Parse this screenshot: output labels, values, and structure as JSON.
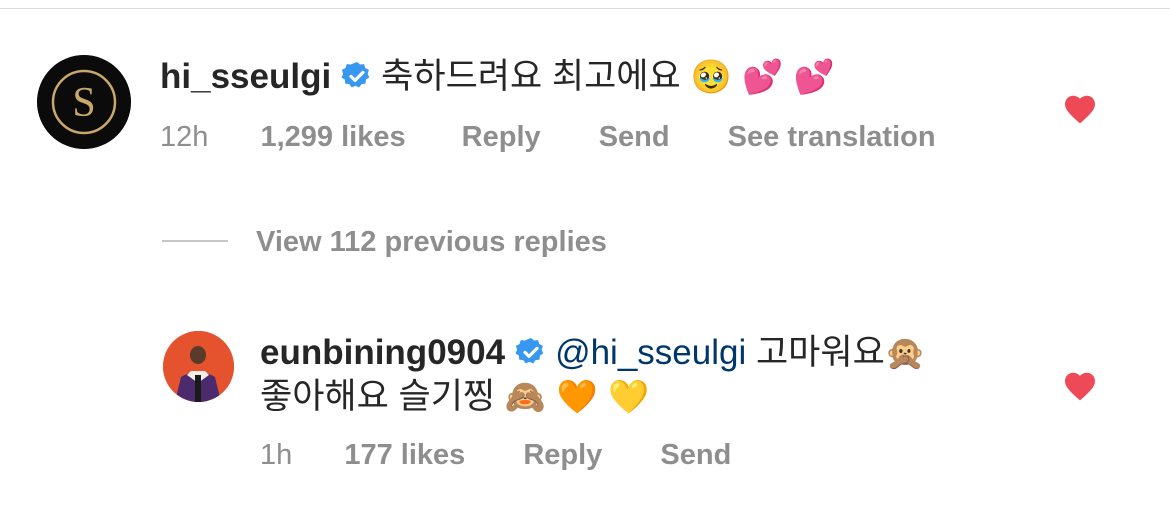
{
  "comment": {
    "username": "hi_sseulgi",
    "text": "축하드려요 최고에요",
    "emojis": "🥹 💕 💕",
    "timestamp": "12h",
    "likes": "1,299 likes",
    "reply_label": "Reply",
    "send_label": "Send",
    "translate_label": "See translation",
    "liked": true
  },
  "view_replies_label": "View 112 previous replies",
  "reply": {
    "username": "eunbining0904",
    "mention": "@hi_sseulgi",
    "text_line1": "고마워요",
    "emoji_line1": "🙊",
    "text_line2": "좋아해요 슬기찡",
    "emoji_line2": "🙈 🧡 💛",
    "timestamp": "1h",
    "likes": "177 likes",
    "reply_label": "Reply",
    "send_label": "Send",
    "liked": true
  },
  "colors": {
    "verified": "#3897f0",
    "heart": "#ed4956",
    "mention": "#00376b",
    "meta": "#8e8e8e"
  },
  "icons": {
    "verified": "verified-badge-icon",
    "heart": "heart-icon"
  }
}
